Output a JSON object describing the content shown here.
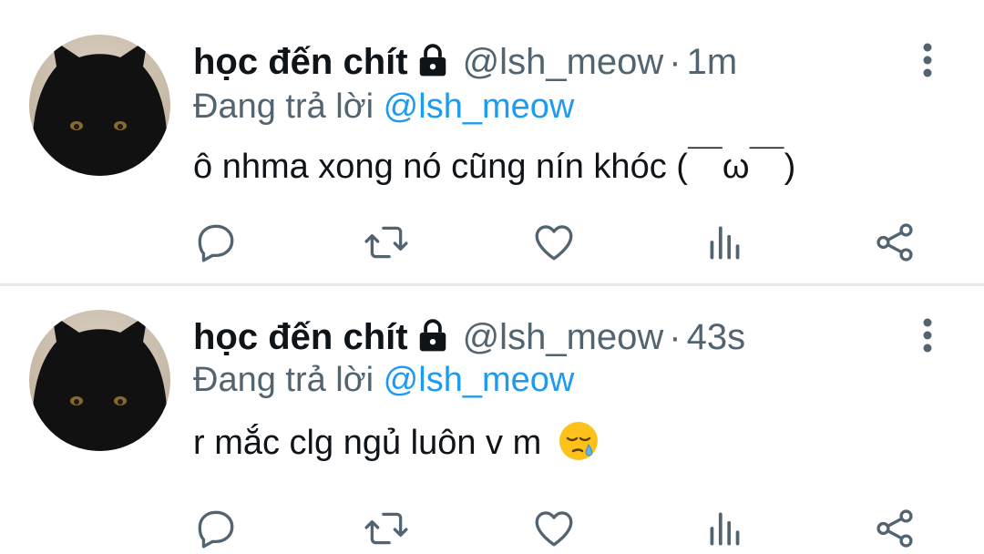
{
  "tweets": [
    {
      "author": {
        "display_name": "học đến chít",
        "handle": "@lsh_meow",
        "protected": true,
        "avatar": "black-cat-photo"
      },
      "time": "1m",
      "separator": "·",
      "reply_to": {
        "prefix": "Đang trả lời",
        "handle": "@lsh_meow"
      },
      "text": "ô nhma xong nó cũng nín khóc (￣ω￣)",
      "actions": [
        "reply-icon",
        "retweet-icon",
        "like-icon",
        "analytics-icon",
        "share-icon"
      ]
    },
    {
      "author": {
        "display_name": "học đến chít",
        "handle": "@lsh_meow",
        "protected": true,
        "avatar": "black-cat-photo"
      },
      "time": "43s",
      "separator": "·",
      "reply_to": {
        "prefix": "Đang trả lời",
        "handle": "@lsh_meow"
      },
      "text": "r mắc clg ngủ luôn v m",
      "emoji": "sleepy-face",
      "actions": [
        "reply-icon",
        "retweet-icon",
        "like-icon",
        "analytics-icon",
        "share-icon"
      ]
    }
  ],
  "colors": {
    "text": "#0f1419",
    "secondary": "#536471",
    "link": "#1d9bf0",
    "divider": "#e6e9ec"
  }
}
